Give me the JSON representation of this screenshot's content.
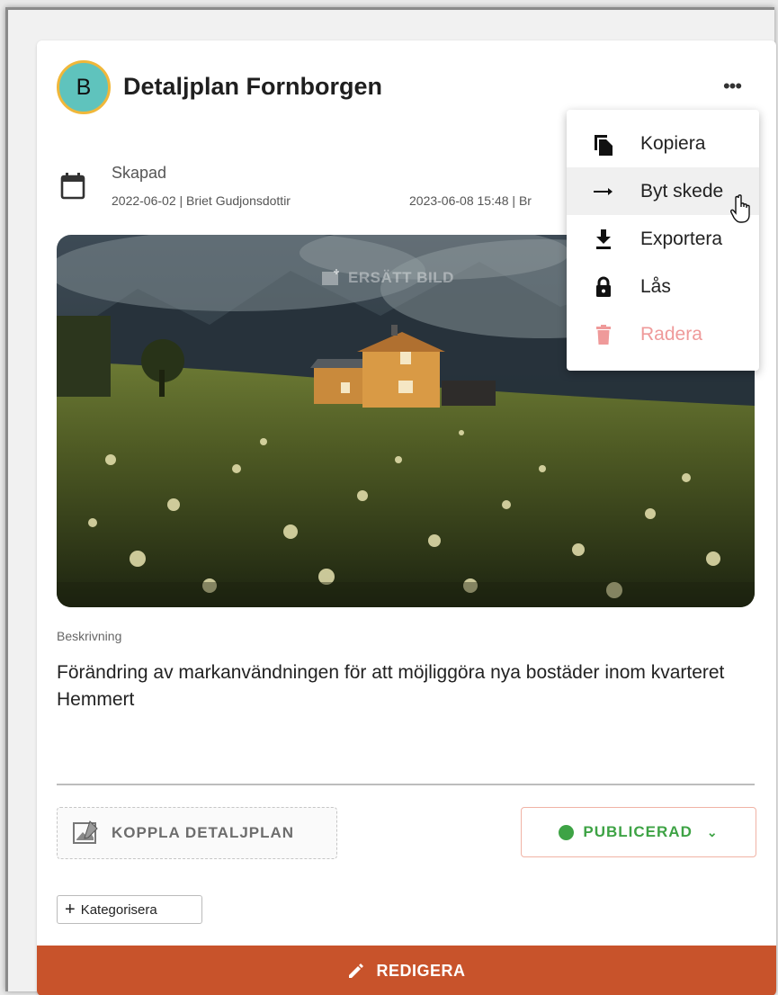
{
  "project": {
    "avatar_letter": "B",
    "title": "Detaljplan Fornborgen",
    "more_label": "•••"
  },
  "meta": {
    "created_label": "Skapad",
    "created_value": "2022-06-02 | Briet Gudjonsdottir",
    "modified_value": "2023-06-08 15:48 | Br"
  },
  "image": {
    "replace_label": "ERSÄTT BILD"
  },
  "description": {
    "label": "Beskrivning",
    "text": "Förändring av markanvändningen för att möjliggöra nya bostäder inom kvarteret Hemmert"
  },
  "actions": {
    "link_plan_label": "KOPPLA DETALJPLAN",
    "status_label": "PUBLICERAD",
    "status_color": "#3ea345",
    "categorize_label": "Kategorisera",
    "edit_label": "REDIGERA",
    "edit_color": "#c8532b"
  },
  "menu": {
    "items": [
      {
        "label": "Kopiera",
        "icon": "copy-icon"
      },
      {
        "label": "Byt skede",
        "icon": "arrow-right-icon",
        "hovered": true
      },
      {
        "label": "Exportera",
        "icon": "download-icon"
      },
      {
        "label": "Lås",
        "icon": "lock-icon"
      },
      {
        "label": "Radera",
        "icon": "trash-icon",
        "danger_color": "#ef9a9a"
      }
    ]
  }
}
